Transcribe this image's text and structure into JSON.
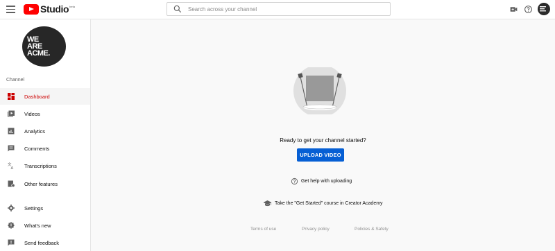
{
  "header": {
    "logo_text": "Studio",
    "logo_badge": "beta",
    "search_placeholder": "Search across your channel",
    "icons": [
      "menu-icon",
      "create-video-icon",
      "help-icon",
      "account-avatar"
    ]
  },
  "sidebar": {
    "avatar_lines": [
      "WE",
      "ARE",
      "ACME."
    ],
    "section_label": "Channel",
    "items": [
      {
        "label": "Dashboard",
        "icon": "dashboard-icon",
        "active": true
      },
      {
        "label": "Videos",
        "icon": "videos-icon",
        "active": false
      },
      {
        "label": "Analytics",
        "icon": "analytics-icon",
        "active": false
      },
      {
        "label": "Comments",
        "icon": "comments-icon",
        "active": false
      },
      {
        "label": "Transcriptions",
        "icon": "transcriptions-icon",
        "active": false
      },
      {
        "label": "Other features",
        "icon": "other-features-icon",
        "active": false
      }
    ],
    "bottom_items": [
      {
        "label": "Settings",
        "icon": "settings-icon"
      },
      {
        "label": "What's new",
        "icon": "whats-new-icon"
      },
      {
        "label": "Send feedback",
        "icon": "feedback-icon"
      }
    ]
  },
  "main": {
    "ready_text": "Ready to get your channel started?",
    "upload_label": "UPLOAD VIDEO",
    "help_link": "Get help with uploading",
    "academy_link": "Take the \"Get Started\" course in Creator Academy",
    "footer": {
      "terms": "Terms of use",
      "privacy": "Privacy policy",
      "policies": "Policies & Safety"
    }
  },
  "colors": {
    "accent_red": "#cc0000",
    "upload_blue": "#065fd4",
    "brand_red": "#ff0000"
  }
}
